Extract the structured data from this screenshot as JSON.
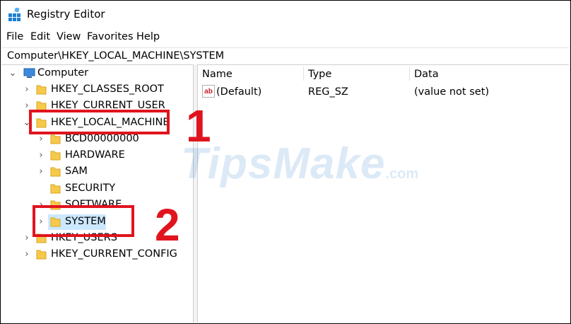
{
  "window": {
    "title": "Registry Editor"
  },
  "menu": [
    "File",
    "Edit",
    "View",
    "Favorites",
    "Help"
  ],
  "address": "Computer\\HKEY_LOCAL_MACHINE\\SYSTEM",
  "tree": {
    "root": "Computer",
    "hives": {
      "classes_root": "HKEY_CLASSES_ROOT",
      "current_user": "HKEY_CURRENT_USER",
      "local_machine": "HKEY_LOCAL_MACHINE",
      "users": "HKEY_USERS",
      "current_config": "HKEY_CURRENT_CONFIG"
    },
    "local_machine_children": [
      "BCD00000000",
      "HARDWARE",
      "SAM",
      "SECURITY",
      "SOFTWARE",
      "SYSTEM"
    ],
    "selected": "SYSTEM"
  },
  "values_list": {
    "columns": [
      "Name",
      "Type",
      "Data"
    ],
    "rows": [
      {
        "name": "(Default)",
        "type": "REG_SZ",
        "data": "(value not set)"
      }
    ]
  },
  "annotations": [
    "1",
    "2"
  ],
  "watermark": {
    "brand": "TipsMake",
    "suffix": ".com"
  },
  "colors": {
    "callout": "#e0141e",
    "selection": "#cce8ff",
    "folder": "#f7c94a",
    "accent": "#1a7fd4"
  }
}
